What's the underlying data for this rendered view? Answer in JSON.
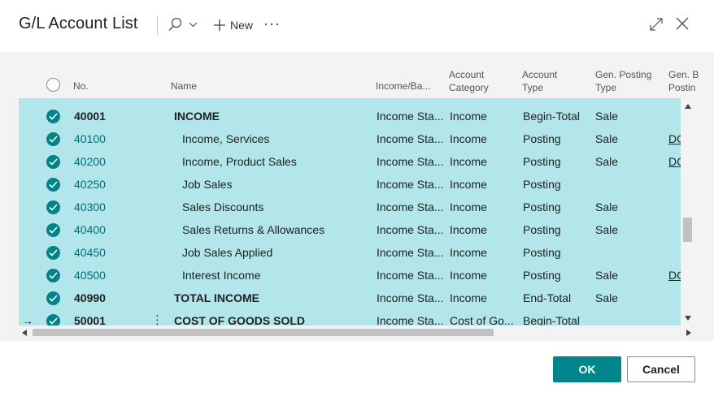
{
  "header": {
    "title": "G/L Account List",
    "new_label": "New"
  },
  "columns": {
    "no": "No.",
    "name": "Name",
    "income_balance": "Income/Ba...",
    "account_category_1": "Account",
    "account_category_2": "Category",
    "account_type_1": "Account",
    "account_type_2": "Type",
    "gen_posting_type_1": "Gen. Posting",
    "gen_posting_type_2": "Type",
    "gen_bus_1": "Gen. B",
    "gen_bus_2": "Postin"
  },
  "rows": [
    {
      "no": "40001",
      "name": "INCOME",
      "income_balance": "Income Sta...",
      "category": "Income",
      "type": "Begin-Total",
      "gen_posting_type": "Sale",
      "gen_bus": "",
      "bold": true
    },
    {
      "no": "40100",
      "name": "Income, Services",
      "income_balance": "Income Sta...",
      "category": "Income",
      "type": "Posting",
      "gen_posting_type": "Sale",
      "gen_bus": "DC",
      "bold": false
    },
    {
      "no": "40200",
      "name": "Income, Product Sales",
      "income_balance": "Income Sta...",
      "category": "Income",
      "type": "Posting",
      "gen_posting_type": "Sale",
      "gen_bus": "DC",
      "bold": false
    },
    {
      "no": "40250",
      "name": "Job Sales",
      "income_balance": "Income Sta...",
      "category": "Income",
      "type": "Posting",
      "gen_posting_type": "",
      "gen_bus": "",
      "bold": false
    },
    {
      "no": "40300",
      "name": "Sales Discounts",
      "income_balance": "Income Sta...",
      "category": "Income",
      "type": "Posting",
      "gen_posting_type": "Sale",
      "gen_bus": "",
      "bold": false
    },
    {
      "no": "40400",
      "name": "Sales Returns & Allowances",
      "income_balance": "Income Sta...",
      "category": "Income",
      "type": "Posting",
      "gen_posting_type": "Sale",
      "gen_bus": "",
      "bold": false
    },
    {
      "no": "40450",
      "name": "Job Sales Applied",
      "income_balance": "Income Sta...",
      "category": "Income",
      "type": "Posting",
      "gen_posting_type": "",
      "gen_bus": "",
      "bold": false
    },
    {
      "no": "40500",
      "name": "Interest Income",
      "income_balance": "Income Sta...",
      "category": "Income",
      "type": "Posting",
      "gen_posting_type": "Sale",
      "gen_bus": "DC",
      "bold": false
    },
    {
      "no": "40990",
      "name": "TOTAL INCOME",
      "income_balance": "Income Sta...",
      "category": "Income",
      "type": "End-Total",
      "gen_posting_type": "Sale",
      "gen_bus": "",
      "bold": true
    },
    {
      "no": "50001",
      "name": "COST OF GOODS SOLD",
      "income_balance": "Income Sta...",
      "category": "Cost of Go...",
      "type": "Begin-Total",
      "gen_posting_type": "",
      "gen_bus": "",
      "bold": true,
      "current": true
    }
  ],
  "footer": {
    "ok_label": "OK",
    "cancel_label": "Cancel"
  },
  "colors": {
    "selected_row_bg": "#b2e6ea",
    "accent": "#00858a",
    "link": "#00707a"
  }
}
